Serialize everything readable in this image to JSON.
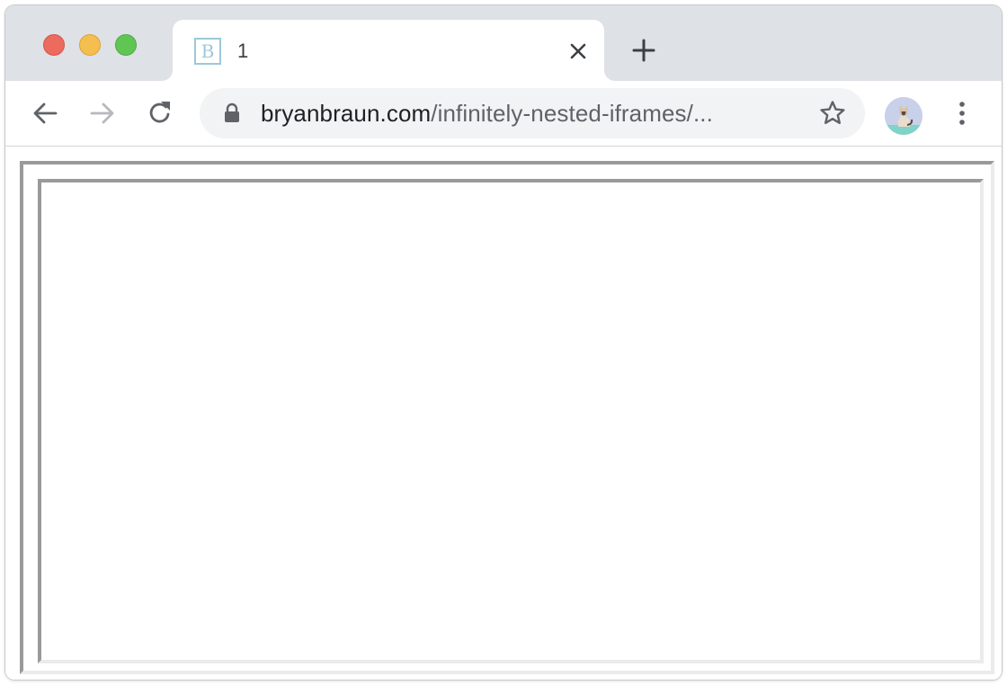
{
  "window": {
    "controls": [
      "close",
      "minimize",
      "maximize"
    ]
  },
  "tab": {
    "favicon_letter": "B",
    "title": "1",
    "close_icon": "close-icon"
  },
  "new_tab_icon": "plus-icon",
  "toolbar": {
    "back_icon": "arrow-left-icon",
    "forward_icon": "arrow-right-icon",
    "reload_icon": "reload-icon",
    "url": {
      "domain": "bryanbraun.com",
      "path": "/infinitely-nested-iframes/..."
    },
    "lock_icon": "lock-icon",
    "bookmark_icon": "star-icon",
    "profile_icon": "avatar",
    "menu_icon": "kebab-menu-icon"
  },
  "colors": {
    "tabstrip": "#dee1e6",
    "omnibox": "#f1f3f4",
    "iframe_border_dark": "#9a9a9a",
    "iframe_border_light": "#ebebeb",
    "favicon": "#9cc8d8"
  }
}
